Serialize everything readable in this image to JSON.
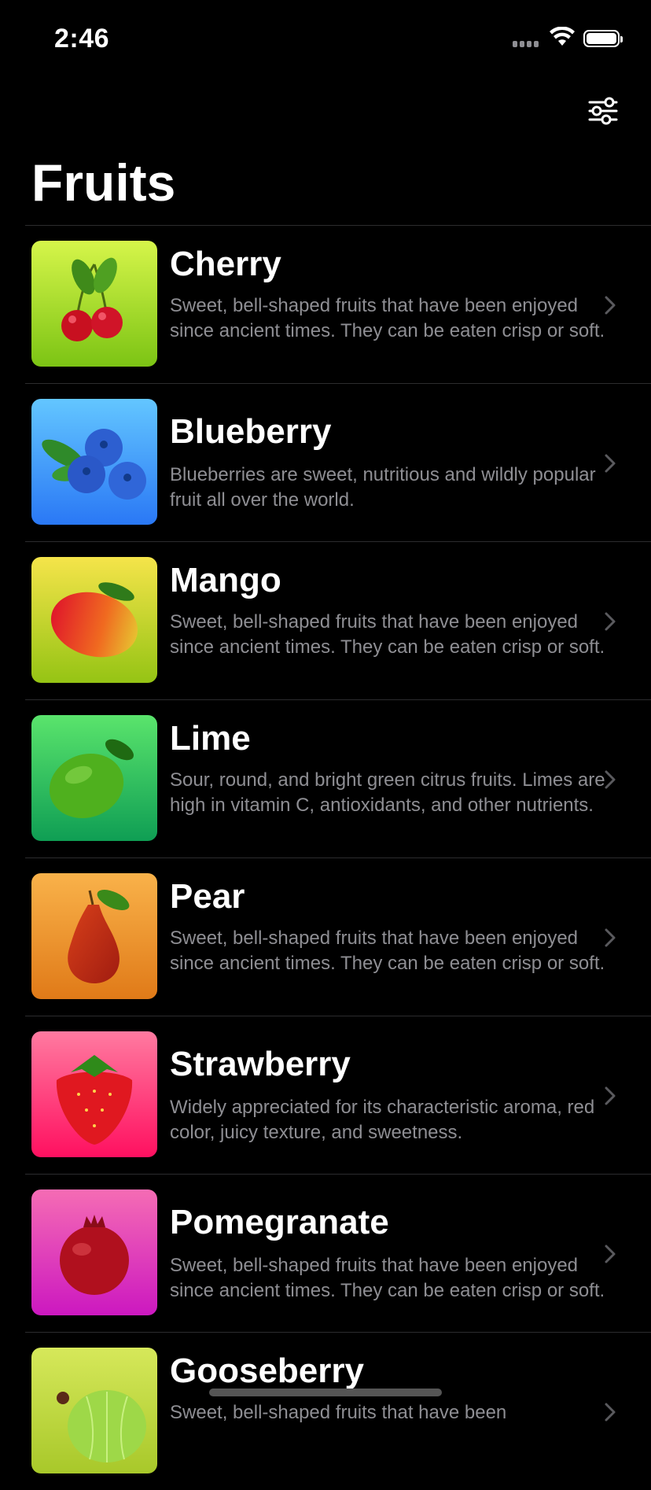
{
  "status": {
    "time": "2:46"
  },
  "page": {
    "title": "Fruits"
  },
  "fruits": [
    {
      "name": "Cherry",
      "description": "Sweet, bell-shaped fruits that have been enjoyed since ancient times. They can be eaten crisp or soft.",
      "gradient": [
        "#d6f54a",
        "#7cc414"
      ]
    },
    {
      "name": "Blueberry",
      "description": "Blueberries are sweet, nutritious and wildly popular fruit all over the world.",
      "gradient": [
        "#63c6ff",
        "#2a78f5"
      ]
    },
    {
      "name": "Mango",
      "description": "Sweet, bell-shaped fruits that have been enjoyed since ancient times. They can be eaten crisp or soft.",
      "gradient": [
        "#f5e44a",
        "#95c414"
      ]
    },
    {
      "name": "Lime",
      "description": "Sour, round, and bright green citrus fruits. Limes are high in vitamin C, antioxidants, and other nutrients.",
      "gradient": [
        "#5ae46c",
        "#0f9e54"
      ]
    },
    {
      "name": "Pear",
      "description": "Sweet, bell-shaped fruits that have been enjoyed since ancient times. They can be eaten crisp or soft.",
      "gradient": [
        "#f9b24a",
        "#e07a18"
      ]
    },
    {
      "name": "Strawberry",
      "description": "Widely appreciated for its characteristic aroma,  red color, juicy texture, and sweetness.",
      "gradient": [
        "#ff7aa0",
        "#ff1060"
      ]
    },
    {
      "name": "Pomegranate",
      "description": "Sweet, bell-shaped fruits that have been enjoyed since ancient times. They can be eaten crisp or soft.",
      "gradient": [
        "#f56cb4",
        "#cc18c0"
      ]
    },
    {
      "name": "Gooseberry",
      "description": "Sweet, bell-shaped fruits that have been",
      "gradient": [
        "#d6e85a",
        "#a8c82a"
      ]
    }
  ]
}
